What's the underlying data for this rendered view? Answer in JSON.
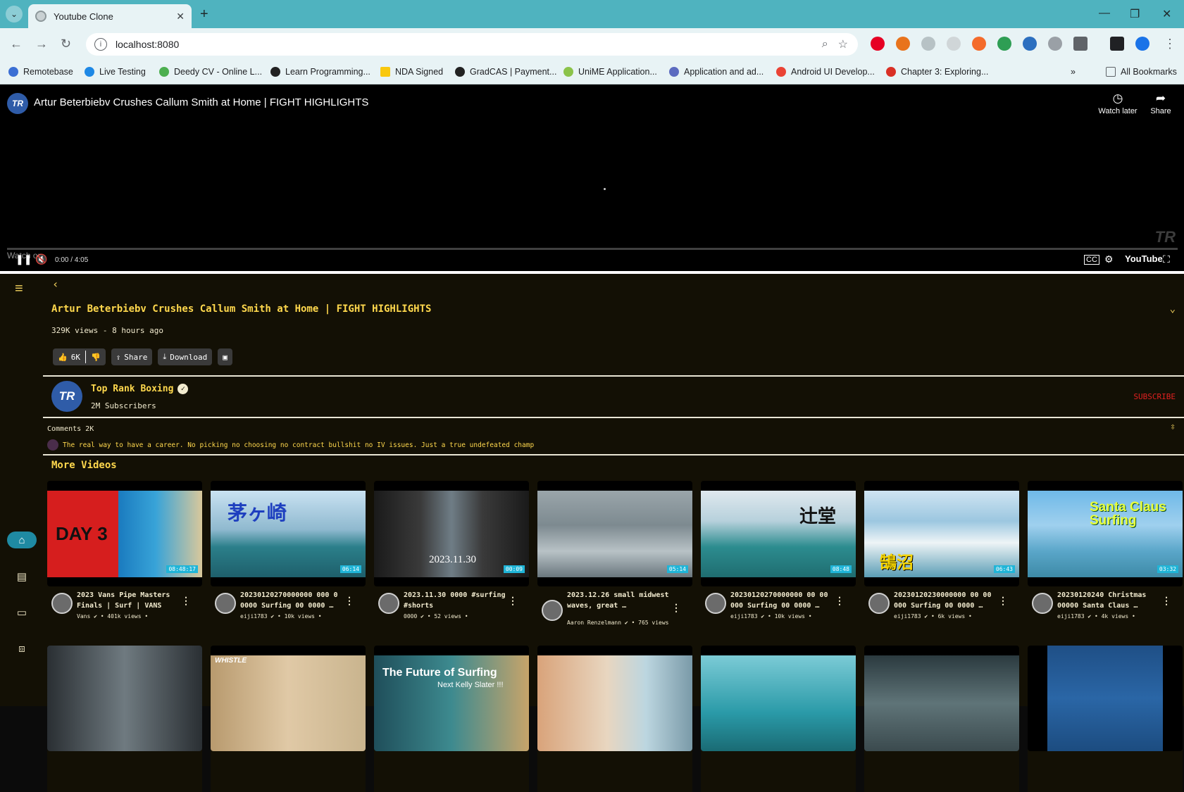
{
  "browser": {
    "tab_title": "Youtube Clone",
    "url": "localhost:8080",
    "bookmarks": [
      "Remotebase",
      "Live Testing",
      "Deedy CV - Online L...",
      "Learn Programming...",
      "NDA Signed",
      "GradCAS | Payment...",
      "UniME Application...",
      "Application and ad...",
      "Android UI Develop...",
      "Chapter 3: Exploring..."
    ],
    "all_bookmarks": "All Bookmarks"
  },
  "player": {
    "title": "Artur Beterbiebv Crushes Callum Smith at Home | FIGHT HIGHLIGHTS",
    "channel_initials": "TR",
    "watch_later": "Watch later",
    "share": "Share",
    "watch_on": "Watch on",
    "time": "0:00 / 4:05",
    "youtube": "YouTube"
  },
  "video": {
    "title": "Artur Beterbiebv Crushes Callum Smith at Home | FIGHT HIGHLIGHTS",
    "meta": "329K views - 8 hours ago",
    "likes": "6K",
    "share_label": "Share",
    "download_label": "Download"
  },
  "channel": {
    "initials": "TR",
    "name": "Top Rank Boxing",
    "subscribers": "2M Subscribers",
    "subscribe_label": "SUBSCRIBE"
  },
  "comments": {
    "heading": "Comments 2K",
    "top_comment": "The real way to have a career. No picking no choosing no contract bullshit no IV issues. Just a true undefeated champ"
  },
  "more_videos": {
    "heading": "More Videos",
    "items": [
      {
        "title": "2023 Vans Pipe Masters Finals | Surf | VANS",
        "meta": "Vans ✔ • 401k views •",
        "duration": "08:48:17",
        "overlay": "DAY 3"
      },
      {
        "title": "20230120270000000 000 0 0000 Surfing 00 0000 …",
        "meta": "eiji1783 ✔ • 10k views •",
        "duration": "06:14",
        "overlay": "茅ヶ崎"
      },
      {
        "title": "2023.11.30 0000 #surfing #shorts",
        "meta": "0000 ✔ • 52 views •",
        "duration": "00:09",
        "overlay": "2023.11.30"
      },
      {
        "title": "2023.12.26 small midwest waves, great …",
        "meta": "Aaron Renzelmann ✔ • 765 views",
        "duration": "05:14",
        "overlay": ""
      },
      {
        "title": "20230120270000000 00 00 000 Surfing 00 0000 …",
        "meta": "eiji1783 ✔ • 10k views •",
        "duration": "08:48",
        "overlay": "辻堂"
      },
      {
        "title": "20230120230000000 00 00 000 Surfing 00 0000 …",
        "meta": "eiji1783 ✔ • 6k views •",
        "duration": "06:43",
        "overlay": "鵠沼"
      },
      {
        "title": "20230120240 Christmas 00000 Santa Claus …",
        "meta": "eiji1783 ✔ • 4k views •",
        "duration": "03:32",
        "overlay": "Santa Claus Surfing"
      }
    ],
    "second_row_overlays": [
      "",
      "WHISTLE",
      "The Future of Surfing",
      "",
      "",
      "",
      ""
    ],
    "second_row_sub": "Next Kelly Slater !!!"
  },
  "colors": {
    "accent_yellow": "#ffd84d",
    "background": "#131005",
    "duration_badge": "#1fb5d8",
    "subscribe": "#e02020"
  }
}
